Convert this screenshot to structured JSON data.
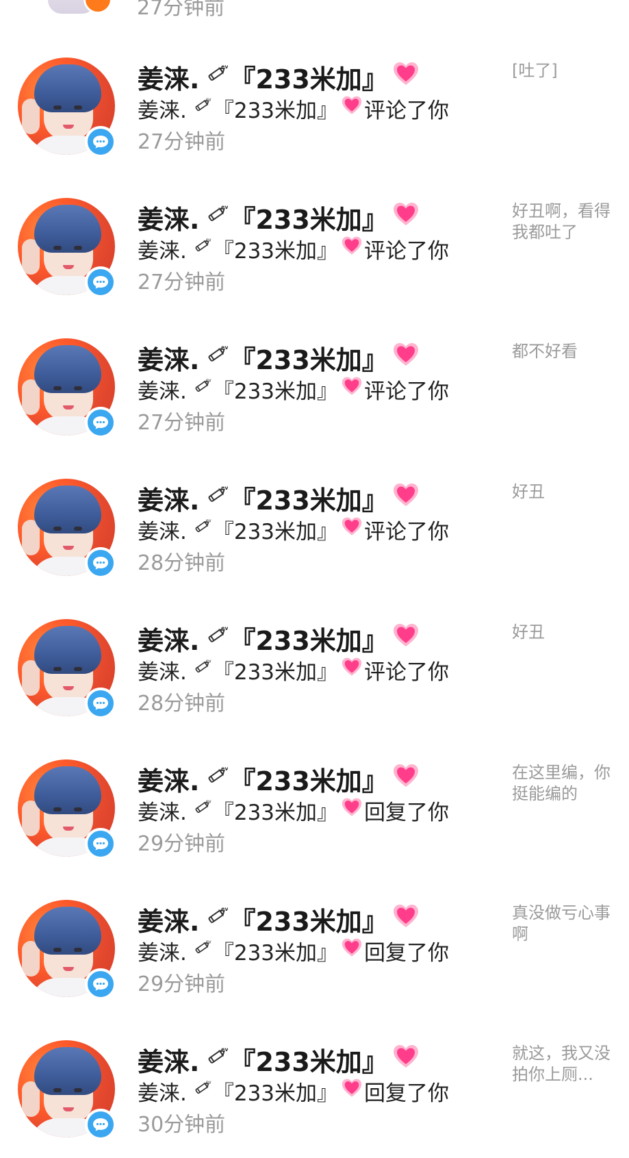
{
  "top_partial": {
    "time": "27分钟前"
  },
  "notifications": [
    {
      "name": "姜涞.",
      "group": "『233米加』",
      "action": "评论了你",
      "time": "27分钟前",
      "preview": "[吐了]"
    },
    {
      "name": "姜涞.",
      "group": "『233米加』",
      "action": "评论了你",
      "time": "27分钟前",
      "preview": "好丑啊，看得我都吐了"
    },
    {
      "name": "姜涞.",
      "group": "『233米加』",
      "action": "评论了你",
      "time": "27分钟前",
      "preview": "都不好看"
    },
    {
      "name": "姜涞.",
      "group": "『233米加』",
      "action": "评论了你",
      "time": "28分钟前",
      "preview": "好丑"
    },
    {
      "name": "姜涞.",
      "group": "『233米加』",
      "action": "评论了你",
      "time": "28分钟前",
      "preview": "好丑"
    },
    {
      "name": "姜涞.",
      "group": "『233米加』",
      "action": "回复了你",
      "time": "29分钟前",
      "preview": "在这里编，你挺能编的"
    },
    {
      "name": "姜涞.",
      "group": "『233米加』",
      "action": "回复了你",
      "time": "29分钟前",
      "preview": "真没做亏心事啊"
    },
    {
      "name": "姜涞.",
      "group": "『233米加』",
      "action": "回复了你",
      "time": "30分钟前",
      "preview": "就这，我又没拍你上厕..."
    }
  ],
  "icons": {
    "badge": "comment-bubble-icon",
    "pen": "pen-emoji-icon",
    "heart": "pink-heart-icon"
  },
  "colors": {
    "badge": "#3aa7f0",
    "heart": "#ff3d8b",
    "time": "#9a9a9a",
    "preview": "#9a9a9a"
  }
}
